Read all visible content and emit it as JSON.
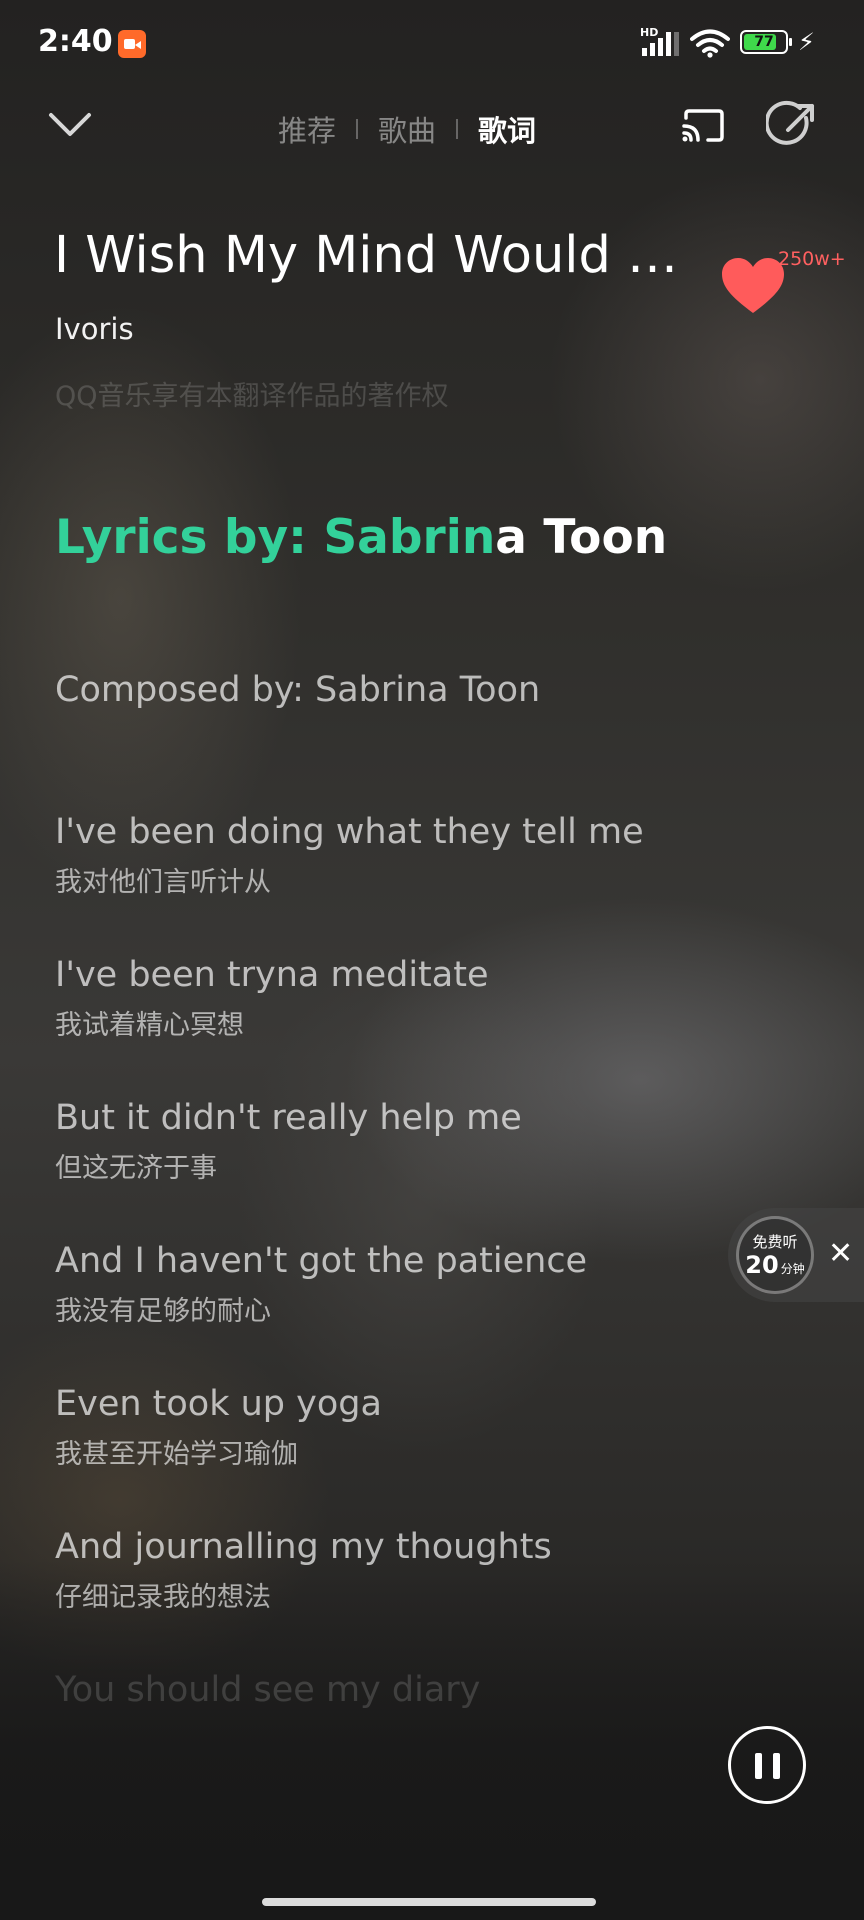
{
  "status_bar": {
    "time": "2:40",
    "hd_label": "HD",
    "battery_level": "77",
    "icons": [
      "screen-record-icon",
      "signal-icon",
      "wifi-icon",
      "battery-icon",
      "charging-icon"
    ]
  },
  "nav": {
    "tabs": [
      {
        "label": "推荐",
        "active": false
      },
      {
        "label": "歌曲",
        "active": false
      },
      {
        "label": "歌词",
        "active": true
      }
    ]
  },
  "song": {
    "title": "I Wish My Mind Would Sh…",
    "artist": "Ivoris",
    "copyright": "QQ音乐享有本翻译作品的著作权",
    "like_count": "250w+"
  },
  "lyrics": {
    "current_sung": "Lyrics by: Sabrin",
    "current_rest": "a Toon",
    "composer": "Composed by: Sabrina Toon",
    "lines": [
      {
        "en": "I've been doing what they tell me",
        "zh": "我对他们言听计从"
      },
      {
        "en": "I've been tryna meditate",
        "zh": "我试着精心冥想"
      },
      {
        "en": "But it didn't really help me",
        "zh": "但这无济于事"
      },
      {
        "en": "And I haven't got the patience",
        "zh": "我没有足够的耐心"
      },
      {
        "en": "Even took up yoga",
        "zh": "我甚至开始学习瑜伽"
      },
      {
        "en": "And journalling my thoughts",
        "zh": "仔细记录我的想法"
      },
      {
        "en": "You should see my diary",
        "zh": ""
      }
    ]
  },
  "free_listen": {
    "label": "免费听",
    "minutes": "20",
    "unit": "分钟",
    "close": "✕"
  },
  "colors": {
    "accent_green": "#33d19a",
    "like_red": "#ff5b5b",
    "battery_green": "#3fd94b"
  }
}
